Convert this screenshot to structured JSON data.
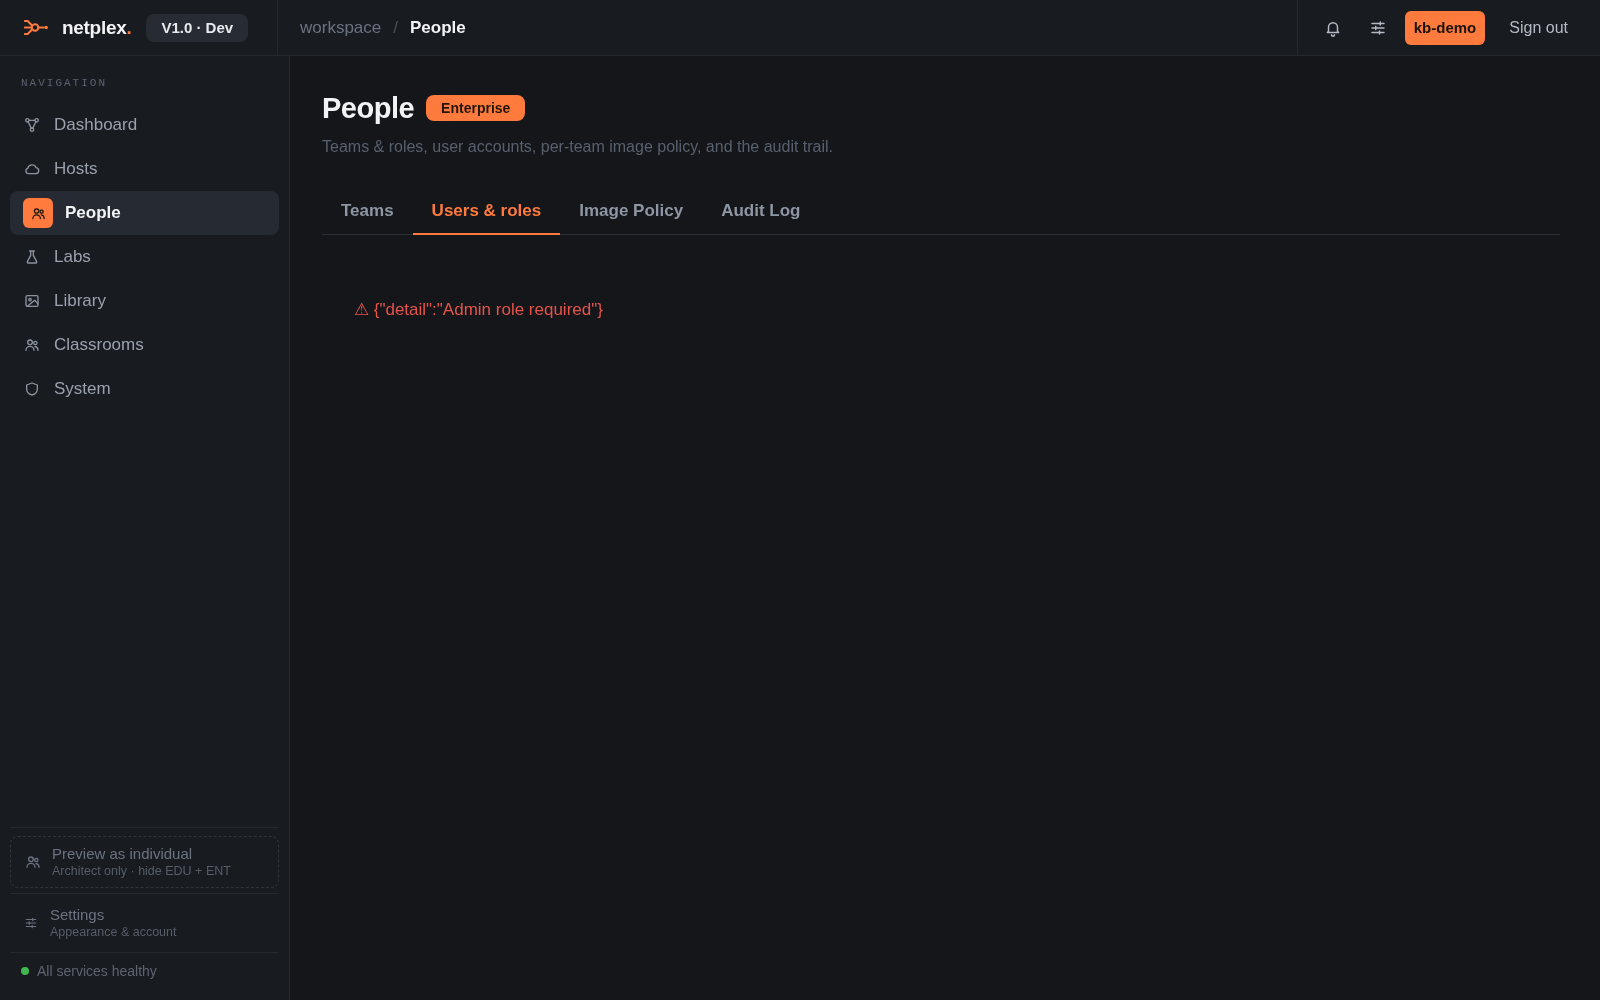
{
  "header": {
    "brand": "netplex.",
    "version": "V1.0 · Dev",
    "breadcrumb": [
      {
        "label": "workspace",
        "current": false
      },
      {
        "label": "People",
        "current": true
      }
    ],
    "separator": "/",
    "user": "kb-demo",
    "sign_out": "Sign out"
  },
  "sidebar": {
    "section_label": "NAVIGATION",
    "items": [
      {
        "label": "Dashboard",
        "selected": false
      },
      {
        "label": "Hosts",
        "selected": false
      },
      {
        "label": "People",
        "selected": true
      },
      {
        "label": "Labs",
        "selected": false
      },
      {
        "label": "Library",
        "selected": false
      },
      {
        "label": "Classrooms",
        "selected": false
      },
      {
        "label": "System",
        "selected": false
      }
    ],
    "preview": {
      "title": "Preview as individual",
      "subtitle": "Architect only · hide EDU + ENT"
    },
    "settings": {
      "title": "Settings",
      "subtitle": "Appearance & account"
    },
    "status": {
      "label": "All services healthy",
      "healthy": true
    }
  },
  "main": {
    "title": "People",
    "badge": "Enterprise",
    "description": "Teams & roles, user accounts, per-team image policy, and the audit trail.",
    "tabs": [
      {
        "label": "Teams",
        "selected": false
      },
      {
        "label": "Users & roles",
        "selected": true
      },
      {
        "label": "Image Policy",
        "selected": false
      },
      {
        "label": "Audit Log",
        "selected": false
      }
    ],
    "error": "⚠ {\"detail\":\"Admin role required\"}"
  }
}
